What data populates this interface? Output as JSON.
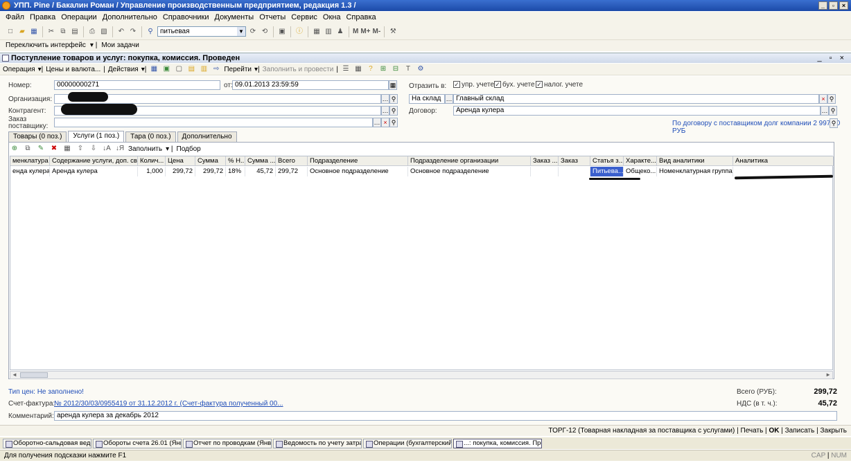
{
  "window": {
    "title": "УПП. Pine / Бакалин Роман / Управление производственным предприятием, редакция 1.3 /"
  },
  "menu": [
    "Файл",
    "Правка",
    "Операции",
    "Дополнительно",
    "Справочники",
    "Документы",
    "Отчеты",
    "Сервис",
    "Окна",
    "Справка"
  ],
  "toolbar": {
    "search_value": "питьевая",
    "m_labels": [
      "M",
      "M+",
      "M-"
    ]
  },
  "toolbar2": {
    "switch_interface": "Переключить интерфейс",
    "my_tasks": "Мои задачи"
  },
  "doc": {
    "title": "Поступление товаров и услуг: покупка, комиссия. Проведен",
    "toolbar": [
      "Операция",
      "Цены и валюта...",
      "Действия",
      "Перейти",
      "Заполнить и провести"
    ],
    "number_label": "Номер:",
    "number": "00000000271",
    "date_label": "от:",
    "date": "09.01.2013 23:59:59",
    "org_label": "Организация:",
    "contractor_label": "Контрагент:",
    "supplier_order_label": "Заказ поставщику:",
    "reflect_label": "Отразить в:",
    "reflect": [
      "упр. учете",
      "бух. учете",
      "налог. учете"
    ],
    "warehouse_type": "На склад",
    "warehouse": "Главный склад",
    "contract_label": "Договор:",
    "contract": "Аренда кулера",
    "debt_note": "По договору с поставщиком долг компании 2 997,20 РУБ"
  },
  "tabs": [
    "Товары (0 поз.)",
    "Услуги (1 поз.)",
    "Тара (0 поз.)",
    "Дополнительно"
  ],
  "tab_toolbar": {
    "fill": "Заполнить",
    "pick": "Подбор"
  },
  "grid": {
    "headers": [
      "менклатура",
      "Содержание услуги, доп. све...",
      "Колич...",
      "Цена",
      "Сумма",
      "% Н...",
      "Сумма ...",
      "Всего",
      "Подразделение",
      "Подразделение организации",
      "Заказ ...",
      "Заказ",
      "Статья з...",
      "Характе...",
      "Вид аналитики",
      "Аналитика"
    ],
    "rows": [
      [
        "енда кулера",
        "Аренда кулера",
        "1,000",
        "299,72",
        "299,72",
        "18%",
        "45,72",
        "299,72",
        "Основное подразделение",
        "Основное подразделение",
        "",
        "",
        "Питьева...",
        "Общеко...",
        "Номенклатурная группа",
        ""
      ]
    ]
  },
  "footer": {
    "price_type": "Тип цен: Не заполнено!",
    "invoice_label": "Счет-фактура:",
    "invoice": "№ 2012/30/03/0955419 от 31.12.2012 г. (Счет-фактура полученный 00...",
    "comment_label": "Комментарий:",
    "comment": "аренда кулера за декабрь 2012",
    "total_label": "Всего (РУБ):",
    "total": "299,72",
    "vat_label": "НДС (в т. ч.):",
    "vat": "45,72"
  },
  "buttons": {
    "torg": "ТОРГ-12 (Товарная накладная за поставщика с услугами)",
    "print": "Печать",
    "ok": "OK",
    "save": "Записать",
    "close": "Закрыть"
  },
  "taskbar": [
    "Оборотно-сальдовая ведом...",
    "Обороты счета 26.01 (Янва...",
    "Отчет по проводкам (Январ...",
    "Ведомость по учету затрат *",
    "Операции (бухгалтерский и...",
    "...: покупка, комиссия. Про..."
  ],
  "status": {
    "hint": "Для получения подсказки нажмите F1",
    "caps": "CAP",
    "num": "NUM"
  }
}
